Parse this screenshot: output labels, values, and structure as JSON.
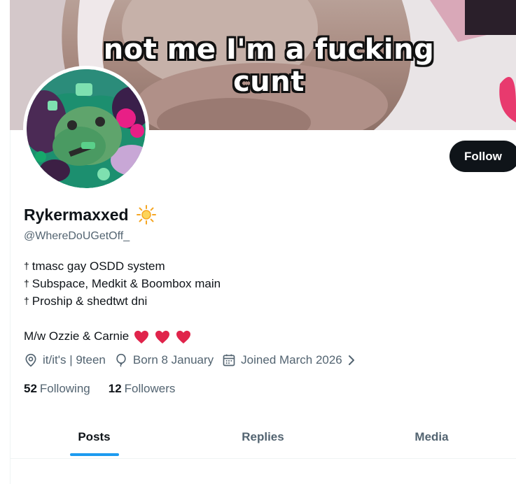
{
  "banner": {
    "caption": "not me I'm a fucking cunt"
  },
  "profile": {
    "display_name": "Rykermaxxed",
    "name_emoji": "sun-icon",
    "handle": "@WhereDoUGetOff_",
    "follow_label": "Follow",
    "bio_lines": [
      "tmasc gay OSDD system",
      "Subspace, Medkit & Boombox main",
      "Proship & shedtwt dni"
    ],
    "bio_dagger": "†",
    "bio_extra": "M/w Ozzie & Carnie",
    "bio_hearts": 3,
    "pronouns": "it/it's | 9teen",
    "birthday": "Born 8 January",
    "joined": "Joined March 2026",
    "following_count": "52",
    "following_label": "Following",
    "followers_count": "12",
    "followers_label": "Followers"
  },
  "tabs": [
    {
      "label": "Posts",
      "active": true
    },
    {
      "label": "Replies",
      "active": false
    },
    {
      "label": "Media",
      "active": false
    }
  ],
  "colors": {
    "accent": "#1d9bf0",
    "heart": "#e0244b",
    "button_bg": "#0f1419",
    "muted_text": "#536471"
  }
}
